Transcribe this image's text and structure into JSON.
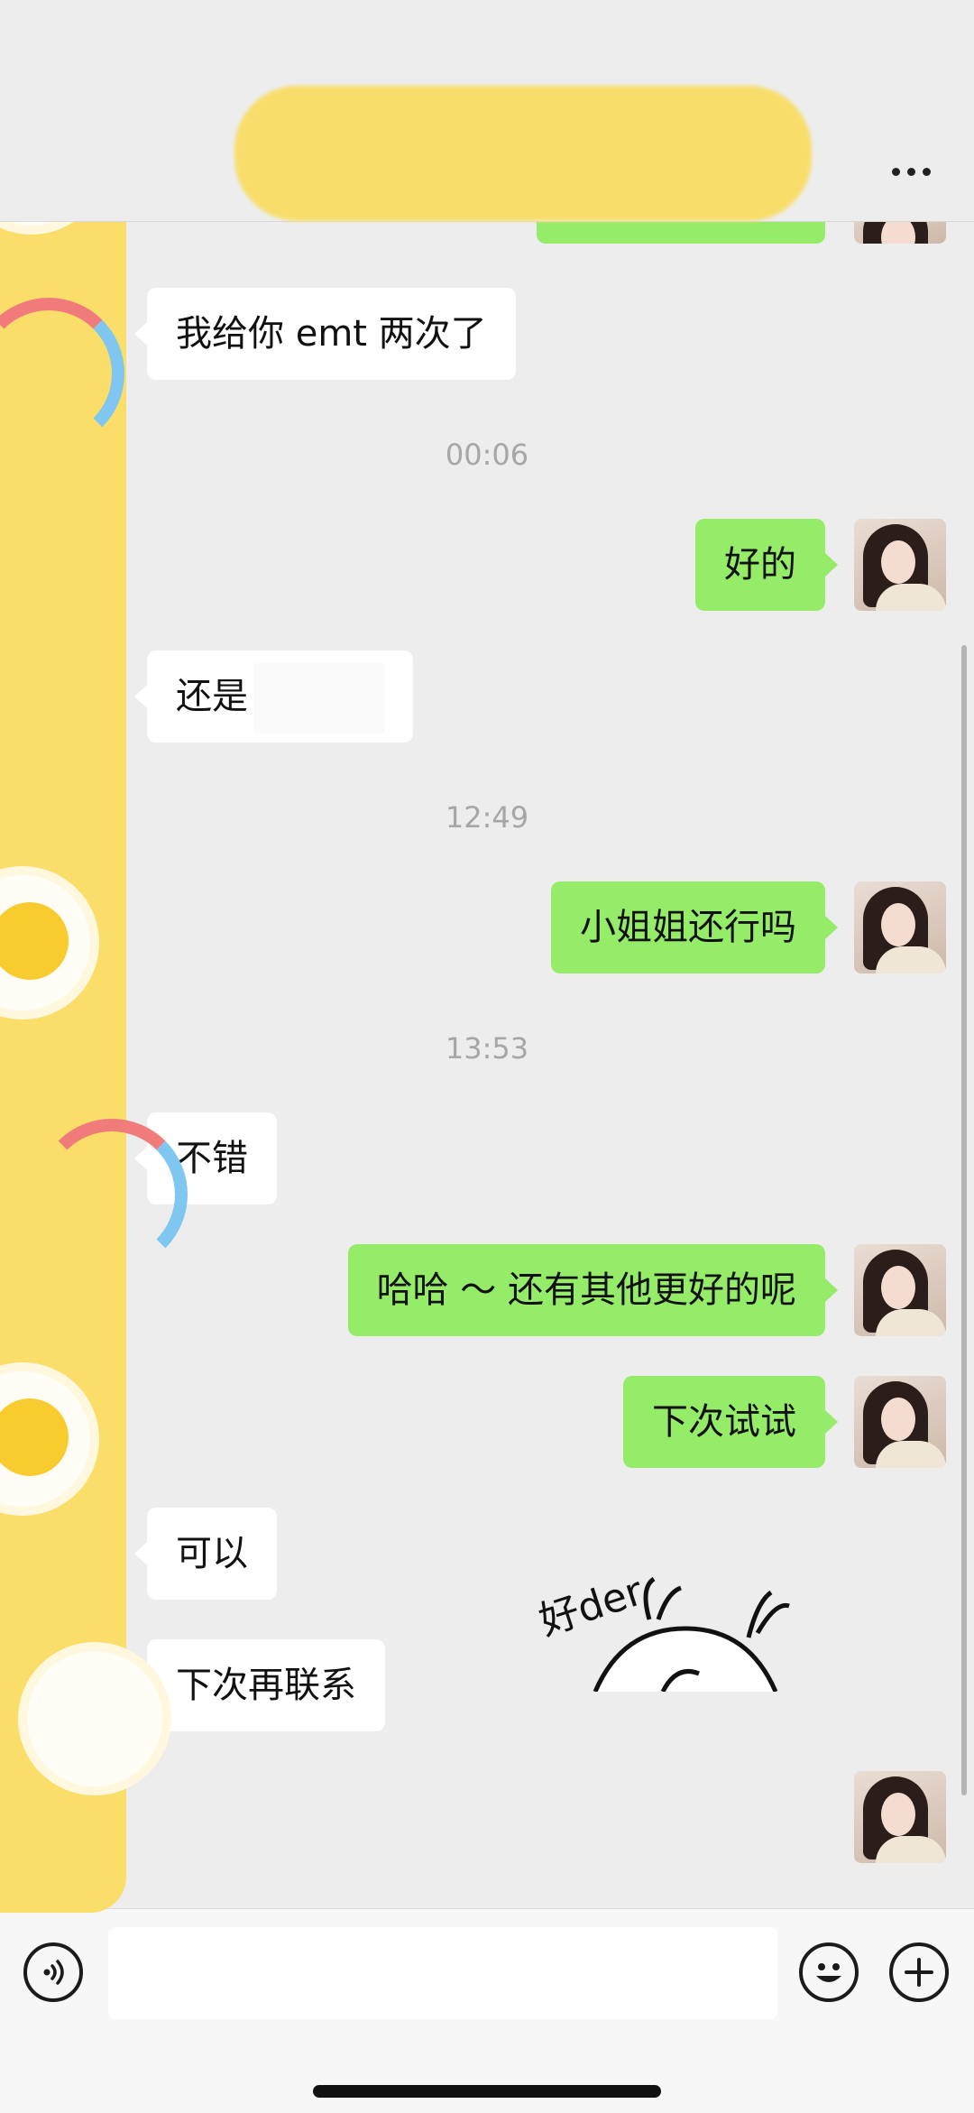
{
  "messages": {
    "m1": "我给你 emt 两次了",
    "t1": "00:06",
    "m2": "好的",
    "m3": "还是",
    "t2": "12:49",
    "m4": "小姐姐还行吗",
    "t3": "13:53",
    "m5": "不错",
    "m6": "哈哈 ～ 还有其他更好的呢",
    "m7": "下次试试",
    "m8": "可以",
    "m9": "下次再联系"
  },
  "sticker": {
    "text": "好der"
  },
  "icons": {
    "more": "more-dots-icon",
    "voice": "voice-icon",
    "emoji": "emoji-icon",
    "plus": "plus-icon"
  },
  "colors": {
    "outgoing_bubble": "#95ec69",
    "incoming_bubble": "#ffffff",
    "background": "#ededed"
  }
}
